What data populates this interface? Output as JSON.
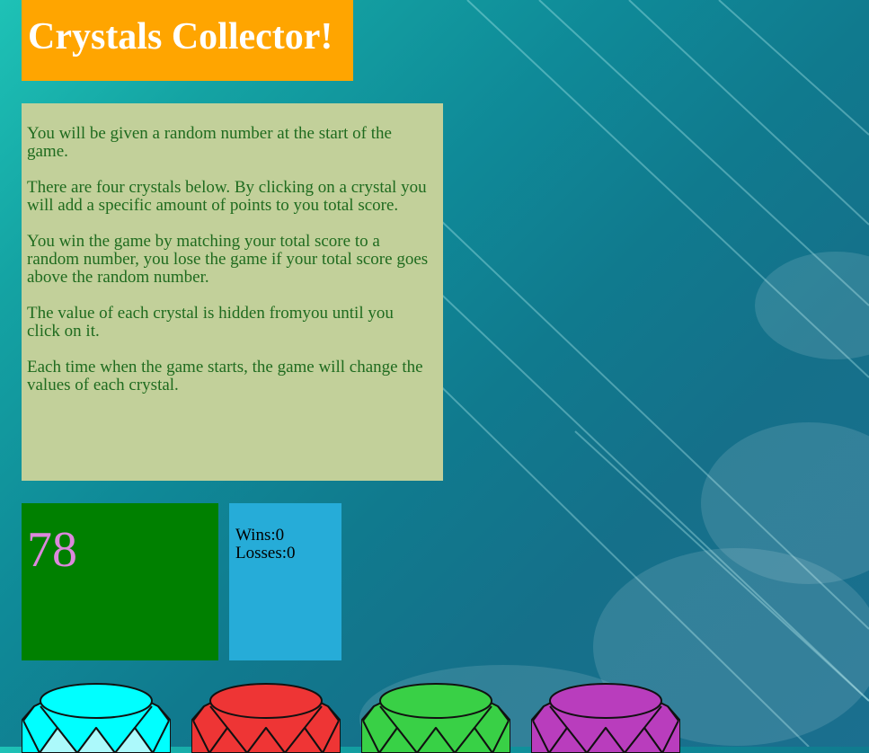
{
  "title": "Crystals Collector!",
  "instructions": [
    "You will be given a random number at the start of the game.",
    "There are four crystals below. By clicking on a crystal you will add a specific amount of points to you total score.",
    "You win the game by matching your total score to a random number, you lose the game if your total score goes above the random number.",
    "The value of each crystal is hidden fromyou until you click on it.",
    "Each time when the game starts, the game will change the values of each crystal."
  ],
  "target_number": "78",
  "score": {
    "wins_label": "Wins:",
    "wins": "0",
    "losses_label": "Losses:",
    "losses": "0"
  },
  "crystals": [
    {
      "name": "cyan-crystal",
      "color": "#00ffff",
      "facet": "#bff8fb"
    },
    {
      "name": "red-crystal",
      "color": "#ee3535",
      "facet": "#ee3535"
    },
    {
      "name": "green-crystal",
      "color": "#39d046",
      "facet": "#39d046"
    },
    {
      "name": "purple-crystal",
      "color": "#b93dbd",
      "facet": "#b93dbd"
    }
  ],
  "colors": {
    "title_bg": "#ffa500",
    "instructions_bg": "#c2d09a",
    "instructions_text": "#1f6b1f",
    "target_bg": "#008000",
    "target_text": "#dd88dd",
    "score_bg": "#26acd8"
  }
}
